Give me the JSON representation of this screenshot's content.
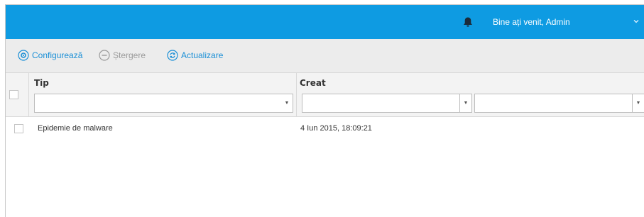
{
  "header": {
    "welcome": "Bine ați venit, Admin",
    "icons": [
      "bell-icon",
      "chevron-down-icon"
    ],
    "color": "#0e9be2"
  },
  "toolbar": {
    "configure_label": "Configurează",
    "delete_label": "Ștergere",
    "refresh_label": "Actualizare",
    "accent": "#1a8fd6",
    "disabled": "#9a9a9a"
  },
  "table": {
    "columns": [
      {
        "label": "Tip"
      },
      {
        "label": "Creat"
      }
    ],
    "filters": {
      "type_value": "",
      "created_from": "",
      "created_to": ""
    },
    "rows": [
      {
        "type": "Epidemie de malware",
        "created": "4 Iun 2015, 18:09:21",
        "checked": false
      }
    ]
  }
}
